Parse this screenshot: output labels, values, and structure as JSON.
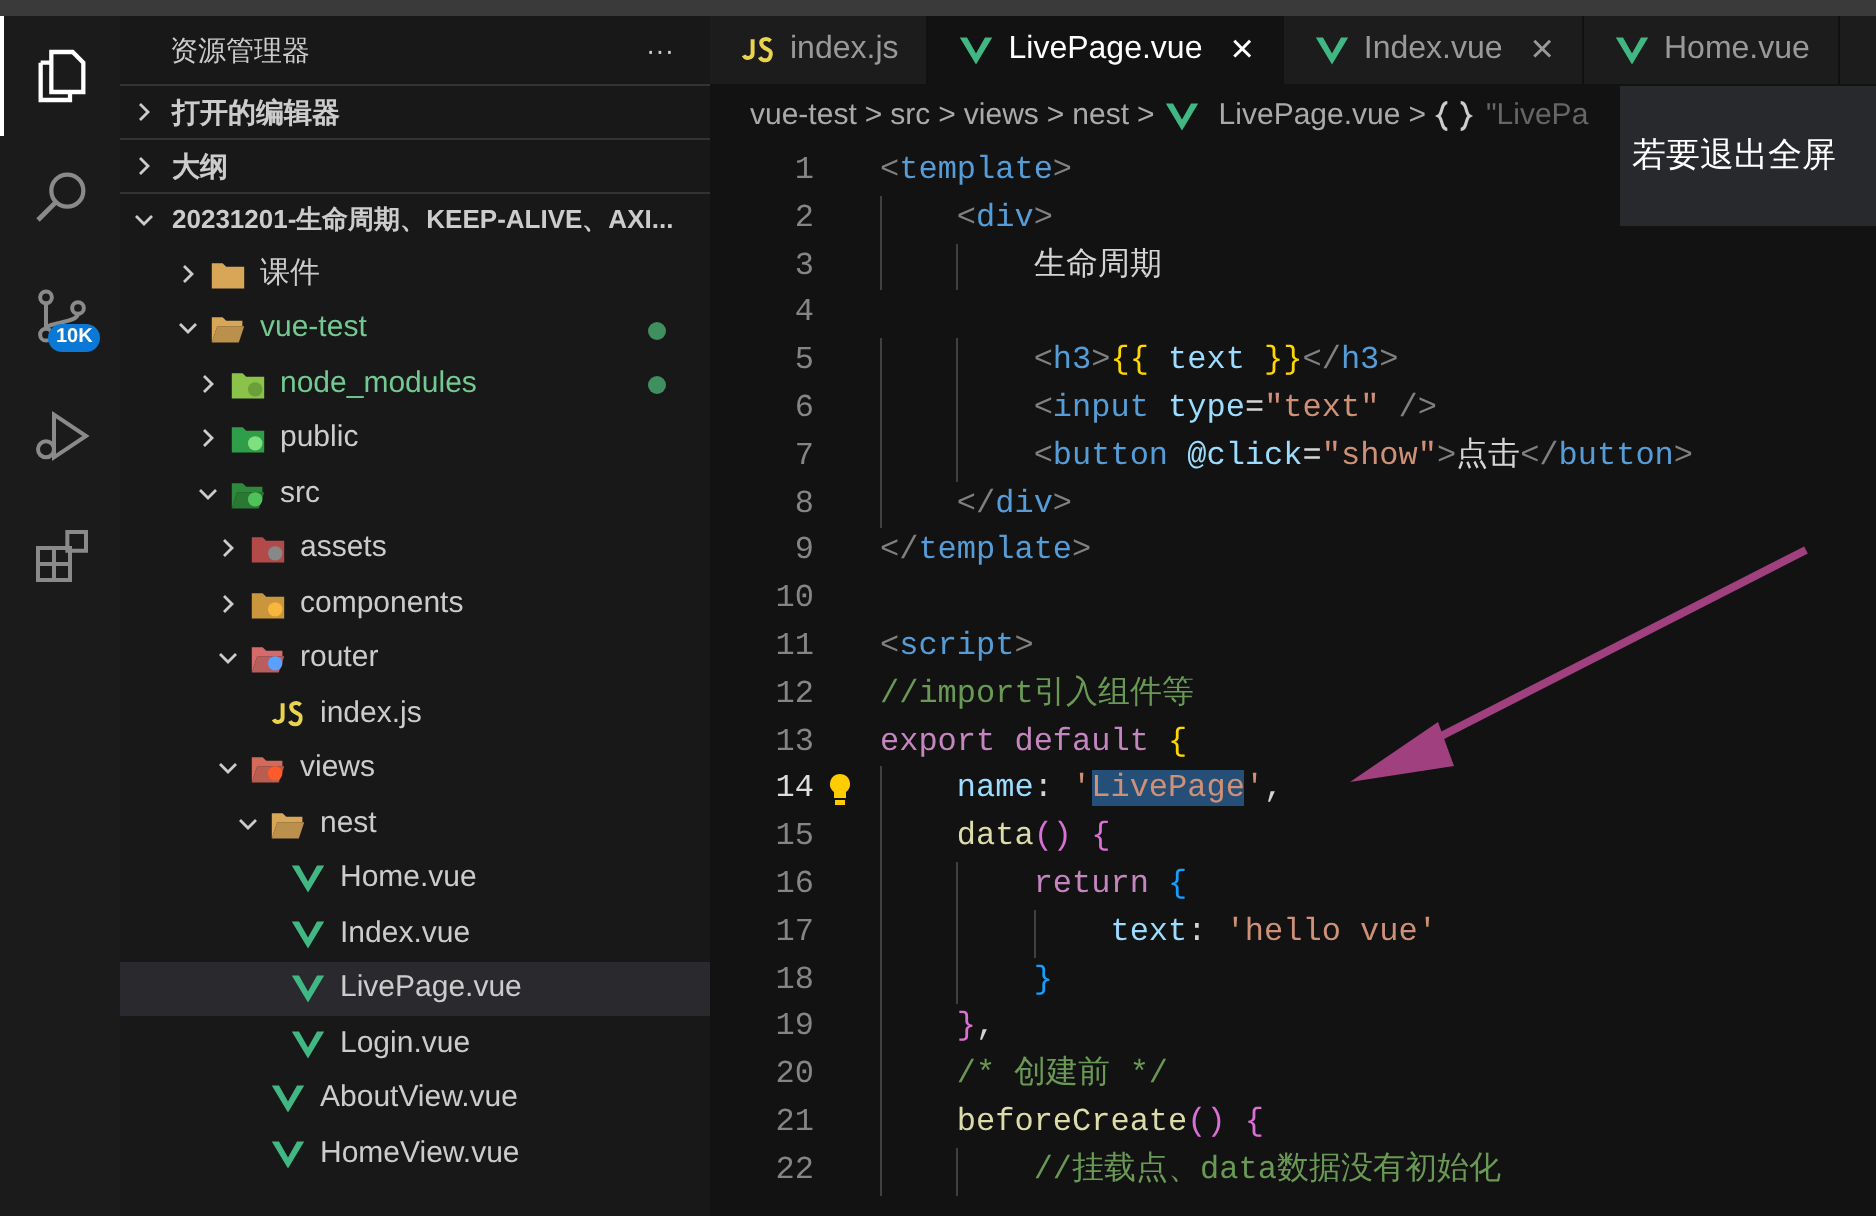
{
  "activity_bar": {
    "items": [
      {
        "kind": "explorer",
        "selected": true
      },
      {
        "kind": "search",
        "selected": false
      },
      {
        "kind": "source-control",
        "selected": false,
        "badge": "10K"
      },
      {
        "kind": "debug",
        "selected": false
      },
      {
        "kind": "extensions",
        "selected": false
      }
    ]
  },
  "sidebar": {
    "title": "资源管理器",
    "more": "···",
    "sections": [
      {
        "label": "打开的编辑器",
        "expanded": false
      },
      {
        "label": "大纲",
        "expanded": false
      }
    ],
    "root": {
      "label": "20231201-生命周期、KEEP-ALIVE、AXI...",
      "expanded": true
    },
    "tree": [
      {
        "label": "课件",
        "kind": "plain-folder",
        "expanded": false
      },
      {
        "label": "vue-test",
        "kind": "plain-folder",
        "expanded": true,
        "modified": true,
        "children": [
          {
            "label": "node_modules",
            "kind": "node-folder",
            "expanded": false,
            "modified": true
          },
          {
            "label": "public",
            "kind": "public-folder",
            "expanded": false
          },
          {
            "label": "src",
            "kind": "src-folder",
            "expanded": true,
            "children": [
              {
                "label": "assets",
                "kind": "assets-folder",
                "expanded": false
              },
              {
                "label": "components",
                "kind": "components-folder",
                "expanded": false
              },
              {
                "label": "router",
                "kind": "router-folder",
                "expanded": true,
                "children": [
                  {
                    "label": "index.js",
                    "kind": "js-file"
                  }
                ]
              },
              {
                "label": "views",
                "kind": "views-folder",
                "expanded": true,
                "children": [
                  {
                    "label": "nest",
                    "kind": "plain-folder",
                    "expanded": true,
                    "children": [
                      {
                        "label": "Home.vue",
                        "kind": "vue-file",
                        "selected": false
                      },
                      {
                        "label": "Index.vue",
                        "kind": "vue-file",
                        "selected": false
                      },
                      {
                        "label": "LivePage.vue",
                        "kind": "vue-file",
                        "selected": true
                      },
                      {
                        "label": "Login.vue",
                        "kind": "vue-file",
                        "selected": false
                      }
                    ]
                  },
                  {
                    "label": "AboutView.vue",
                    "kind": "vue-file",
                    "selected": false
                  },
                  {
                    "label": "HomeView.vue",
                    "kind": "vue-file",
                    "selected": false
                  }
                ]
              }
            ]
          }
        ]
      }
    ]
  },
  "tabs": [
    {
      "label": "index.js",
      "kind": "js-file",
      "selected": false
    },
    {
      "label": "LivePage.vue",
      "kind": "vue-file",
      "selected": true,
      "close": "×"
    },
    {
      "label": "Index.vue",
      "kind": "vue-file",
      "selected": false,
      "close": "×"
    },
    {
      "label": "Home.vue",
      "kind": "vue-file",
      "selected": false
    }
  ],
  "breadcrumb": [
    {
      "label": "vue-test"
    },
    {
      "label": "src"
    },
    {
      "label": "views"
    },
    {
      "label": "nest"
    },
    {
      "label": "LivePage.vue",
      "kind": "vue-file"
    },
    {
      "label": "\"LivePa",
      "kind": "object"
    }
  ],
  "breadcrumb_separator": ">",
  "editor": {
    "lines": [
      {
        "number": "1",
        "tokens": [
          {
            "text": "<",
            "kind": "bracket"
          },
          {
            "text": "template",
            "kind": "tag"
          },
          {
            "text": ">",
            "kind": "bracket"
          }
        ]
      },
      {
        "number": "2",
        "tokens": [
          {
            "text": "    <",
            "kind": "bracket"
          },
          {
            "text": "div",
            "kind": "tag"
          },
          {
            "text": ">",
            "kind": "bracket"
          }
        ]
      },
      {
        "number": "3",
        "tokens": [
          {
            "text": "        生命周期",
            "kind": "plain"
          }
        ]
      },
      {
        "number": "4"
      },
      {
        "number": "5",
        "tokens": [
          {
            "text": "        <",
            "kind": "bracket"
          },
          {
            "text": "h3",
            "kind": "tag"
          },
          {
            "text": ">",
            "kind": "bracket"
          },
          {
            "text": "{{",
            "kind": "brace1"
          },
          {
            "text": " text ",
            "kind": "variable"
          },
          {
            "text": "}}",
            "kind": "brace1"
          },
          {
            "text": "</",
            "kind": "bracket"
          },
          {
            "text": "h3",
            "kind": "tag"
          },
          {
            "text": ">",
            "kind": "bracket"
          }
        ]
      },
      {
        "number": "6",
        "tokens": [
          {
            "text": "        <",
            "kind": "bracket"
          },
          {
            "text": "input",
            "kind": "tag"
          },
          {
            "text": " type",
            "kind": "variable"
          },
          {
            "text": "=",
            "kind": "plain"
          },
          {
            "text": "\"text\"",
            "kind": "string"
          },
          {
            "text": " />",
            "kind": "bracket"
          }
        ]
      },
      {
        "number": "7",
        "tokens": [
          {
            "text": "        <",
            "kind": "bracket"
          },
          {
            "text": "button",
            "kind": "tag"
          },
          {
            "text": " @click",
            "kind": "variable"
          },
          {
            "text": "=",
            "kind": "plain"
          },
          {
            "text": "\"show\"",
            "kind": "string"
          },
          {
            "text": ">",
            "kind": "bracket"
          },
          {
            "text": "点击",
            "kind": "plain"
          },
          {
            "text": "</",
            "kind": "bracket"
          },
          {
            "text": "button",
            "kind": "tag"
          },
          {
            "text": ">",
            "kind": "bracket"
          }
        ]
      },
      {
        "number": "8",
        "tokens": [
          {
            "text": "    </",
            "kind": "bracket"
          },
          {
            "text": "div",
            "kind": "tag"
          },
          {
            "text": ">",
            "kind": "bracket"
          }
        ]
      },
      {
        "number": "9",
        "tokens": [
          {
            "text": "</",
            "kind": "bracket"
          },
          {
            "text": "template",
            "kind": "tag"
          },
          {
            "text": ">",
            "kind": "bracket"
          }
        ]
      },
      {
        "number": "10"
      },
      {
        "number": "11",
        "tokens": [
          {
            "text": "<",
            "kind": "bracket"
          },
          {
            "text": "script",
            "kind": "tag"
          },
          {
            "text": ">",
            "kind": "bracket"
          }
        ]
      },
      {
        "number": "12",
        "tokens": [
          {
            "text": "//import引入组件等",
            "kind": "comment"
          }
        ]
      },
      {
        "number": "13",
        "tokens": [
          {
            "text": "export default ",
            "kind": "keyword"
          },
          {
            "text": "{",
            "kind": "brace1"
          }
        ]
      },
      {
        "number": "14",
        "current": true,
        "lightbulb": true,
        "tokens": [
          {
            "text": "    name",
            "kind": "variable"
          },
          {
            "text": ": ",
            "kind": "plain"
          },
          {
            "text": "'",
            "kind": "string"
          },
          {
            "text": "LivePage",
            "kind": "string",
            "selected": true
          },
          {
            "text": "'",
            "kind": "string"
          },
          {
            "text": ",",
            "kind": "plain"
          }
        ]
      },
      {
        "number": "15",
        "tokens": [
          {
            "text": "    data",
            "kind": "function"
          },
          {
            "text": "()",
            "kind": "brace2"
          },
          {
            "text": " {",
            "kind": "brace2"
          }
        ]
      },
      {
        "number": "16",
        "tokens": [
          {
            "text": "        return ",
            "kind": "keyword"
          },
          {
            "text": "{",
            "kind": "brace3"
          }
        ]
      },
      {
        "number": "17",
        "tokens": [
          {
            "text": "            text",
            "kind": "variable"
          },
          {
            "text": ": ",
            "kind": "plain"
          },
          {
            "text": "'hello vue'",
            "kind": "string"
          }
        ]
      },
      {
        "number": "18",
        "tokens": [
          {
            "text": "        }",
            "kind": "brace3"
          }
        ]
      },
      {
        "number": "19",
        "tokens": [
          {
            "text": "    }",
            "kind": "brace2"
          },
          {
            "text": ",",
            "kind": "plain"
          }
        ]
      },
      {
        "number": "20",
        "tokens": [
          {
            "text": "    /* 创建前 */",
            "kind": "comment"
          }
        ]
      },
      {
        "number": "21",
        "tokens": [
          {
            "text": "    beforeCreate",
            "kind": "function"
          },
          {
            "text": "()",
            "kind": "brace2"
          },
          {
            "text": " {",
            "kind": "brace2"
          }
        ]
      },
      {
        "number": "22",
        "tokens": [
          {
            "text": "        //挂载点、data数据没有初始化",
            "kind": "comment"
          }
        ]
      }
    ]
  },
  "fullscreen_notice": {
    "text": "若要退出全屏"
  }
}
